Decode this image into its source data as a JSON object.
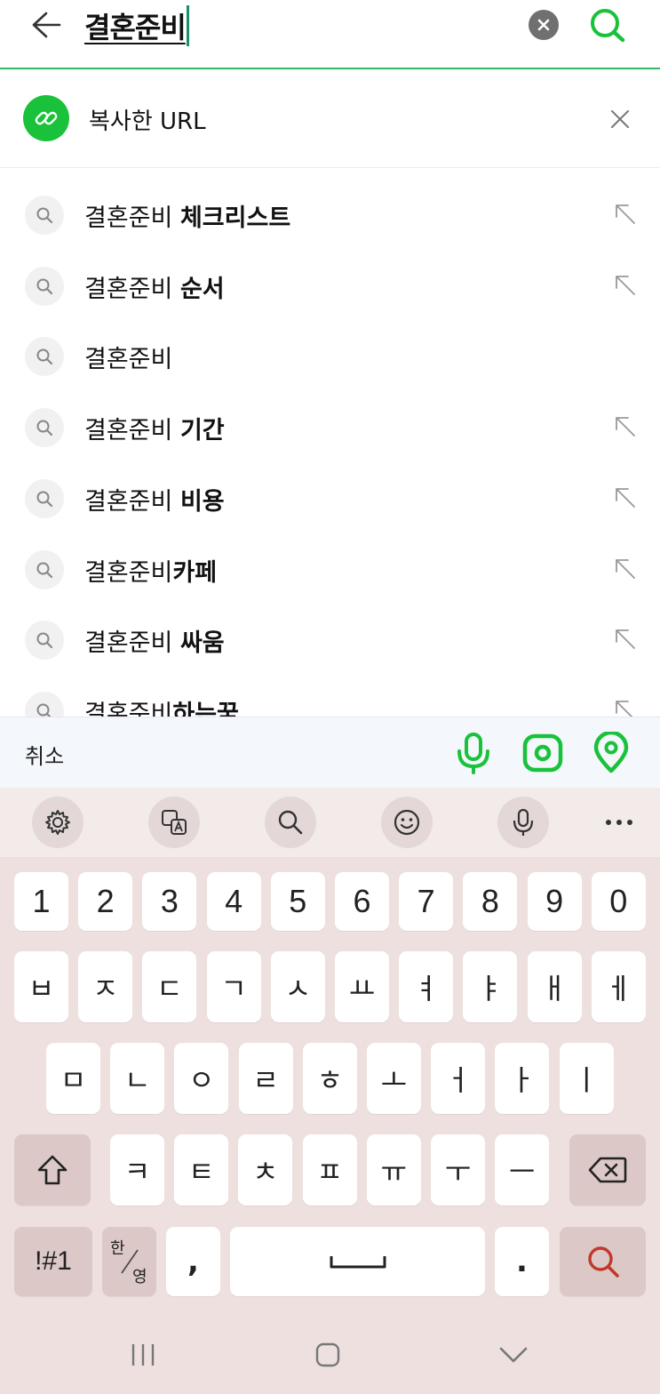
{
  "search": {
    "query": "결혼준비"
  },
  "copied_url": {
    "label": "복사한 URL"
  },
  "suggestions": [
    {
      "prefix": "결혼준비 ",
      "bold": "체크리스트",
      "arrow": true
    },
    {
      "prefix": "결혼준비 ",
      "bold": "순서",
      "arrow": true
    },
    {
      "prefix": "결혼준비",
      "bold": "",
      "arrow": false
    },
    {
      "prefix": "결혼준비 ",
      "bold": "기간",
      "arrow": true
    },
    {
      "prefix": "결혼준비 ",
      "bold": "비용",
      "arrow": true
    },
    {
      "prefix": "결혼준비",
      "bold": "카페",
      "arrow": true
    },
    {
      "prefix": "결혼준비 ",
      "bold": "싸움",
      "arrow": true
    },
    {
      "prefix": "결혼준비",
      "bold": "하는꿈",
      "arrow": true
    }
  ],
  "action_bar": {
    "cancel_label": "취소",
    "icons": [
      "microphone-icon",
      "lens-icon",
      "location-pin-icon"
    ],
    "accent_color": "#19c23a"
  },
  "keyboard": {
    "toolbar_icons": [
      "gear-icon",
      "translate-icon",
      "search-icon",
      "emoji-icon",
      "microphone-icon",
      "more-icon"
    ],
    "row_numbers": [
      "1",
      "2",
      "3",
      "4",
      "5",
      "6",
      "7",
      "8",
      "9",
      "0"
    ],
    "row1": [
      "ㅂ",
      "ㅈ",
      "ㄷ",
      "ㄱ",
      "ㅅ",
      "ㅛ",
      "ㅕ",
      "ㅑ",
      "ㅐ",
      "ㅔ"
    ],
    "row2": [
      "ㅁ",
      "ㄴ",
      "ㅇ",
      "ㄹ",
      "ㅎ",
      "ㅗ",
      "ㅓ",
      "ㅏ",
      "ㅣ"
    ],
    "row3": [
      "ㅋ",
      "ㅌ",
      "ㅊ",
      "ㅍ",
      "ㅠ",
      "ㅜ",
      "ㅡ"
    ],
    "symbols_label": "!#1",
    "lang_top": "한",
    "lang_bottom": "영",
    "comma": ",",
    "period": ".",
    "search_key_color": "#c0392b"
  },
  "system_nav": [
    "recent-apps-icon",
    "home-icon",
    "hide-keyboard-icon"
  ]
}
